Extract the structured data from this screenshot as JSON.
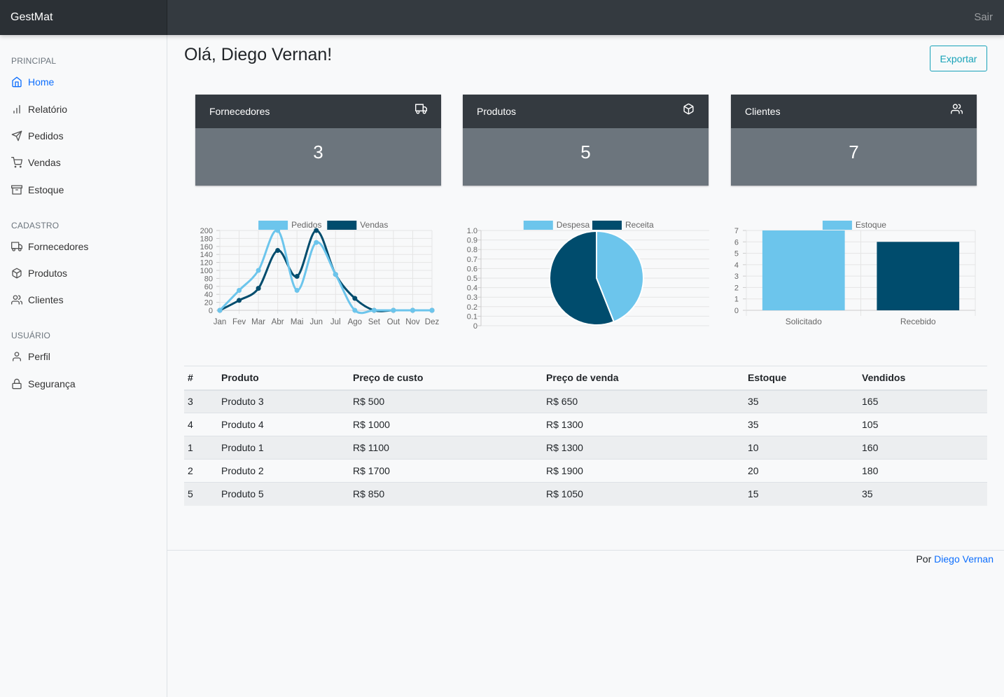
{
  "app": {
    "brand": "GestMat",
    "signout": "Sair"
  },
  "sidebar": {
    "sections": [
      {
        "heading": "PRINCIPAL",
        "items": [
          {
            "label": "Home",
            "icon": "home-icon",
            "active": true
          },
          {
            "label": "Relatório",
            "icon": "bar-chart-icon"
          },
          {
            "label": "Pedidos",
            "icon": "send-icon"
          },
          {
            "label": "Vendas",
            "icon": "shopping-cart-icon"
          },
          {
            "label": "Estoque",
            "icon": "archive-icon"
          }
        ]
      },
      {
        "heading": "CADASTRO",
        "items": [
          {
            "label": "Fornecedores",
            "icon": "truck-icon"
          },
          {
            "label": "Produtos",
            "icon": "package-icon"
          },
          {
            "label": "Clientes",
            "icon": "users-icon"
          }
        ]
      },
      {
        "heading": "USUÁRIO",
        "items": [
          {
            "label": "Perfil",
            "icon": "user-icon"
          },
          {
            "label": "Segurança",
            "icon": "lock-icon"
          }
        ]
      }
    ]
  },
  "main": {
    "greeting": "Olá, Diego Vernan!",
    "export_label": "Exportar",
    "cards": [
      {
        "title": "Fornecedores",
        "value": "3",
        "icon": "truck-icon"
      },
      {
        "title": "Produtos",
        "value": "5",
        "icon": "package-icon"
      },
      {
        "title": "Clientes",
        "value": "7",
        "icon": "users-icon"
      }
    ]
  },
  "colors": {
    "light": "#6cc5ec",
    "dark": "#004c6d",
    "accent": "#0d6efd",
    "outline": "#17a2b8"
  },
  "chart_data": [
    {
      "type": "line",
      "categories": [
        "Jan",
        "Fev",
        "Mar",
        "Abr",
        "Mai",
        "Jun",
        "Jul",
        "Ago",
        "Set",
        "Out",
        "Nov",
        "Dez"
      ],
      "series": [
        {
          "name": "Pedidos",
          "values": [
            0,
            50,
            100,
            200,
            50,
            170,
            90,
            0,
            0,
            0,
            0,
            0
          ]
        },
        {
          "name": "Vendas",
          "values": [
            0,
            25,
            55,
            150,
            85,
            200,
            90,
            30,
            0,
            0,
            0,
            0
          ]
        }
      ],
      "yticks": [
        "0",
        "20",
        "40",
        "60",
        "80",
        "100",
        "120",
        "140",
        "160",
        "180",
        "200"
      ],
      "ylim": [
        0,
        200
      ],
      "legend": "top",
      "grid": true
    },
    {
      "type": "pie",
      "series": [
        {
          "name": "Despesa",
          "value": 0.44
        },
        {
          "name": "Receita",
          "value": 0.56
        }
      ],
      "yticks": [
        "0",
        "0.1",
        "0.2",
        "0.3",
        "0.4",
        "0.5",
        "0.6",
        "0.7",
        "0.8",
        "0.9",
        "1.0"
      ],
      "legend": "top",
      "grid": true
    },
    {
      "type": "bar",
      "categories": [
        "Solicitado",
        "Recebido"
      ],
      "series": [
        {
          "name": "Estoque",
          "values": [
            7,
            6
          ]
        }
      ],
      "yticks": [
        "0",
        "1",
        "2",
        "3",
        "4",
        "5",
        "6",
        "7"
      ],
      "ylim": [
        0,
        7
      ],
      "legend": "top",
      "grid": true
    }
  ],
  "table": {
    "headers": [
      "#",
      "Produto",
      "Preço de custo",
      "Preço de venda",
      "Estoque",
      "Vendidos"
    ],
    "rows": [
      [
        "3",
        "Produto 3",
        "R$ 500",
        "R$ 650",
        "35",
        "165"
      ],
      [
        "4",
        "Produto 4",
        "R$ 1000",
        "R$ 1300",
        "35",
        "105"
      ],
      [
        "1",
        "Produto 1",
        "R$ 1100",
        "R$ 1300",
        "10",
        "160"
      ],
      [
        "2",
        "Produto 2",
        "R$ 1700",
        "R$ 1900",
        "20",
        "180"
      ],
      [
        "5",
        "Produto 5",
        "R$ 850",
        "R$ 1050",
        "15",
        "35"
      ]
    ]
  },
  "footer": {
    "prefix": "Por",
    "author": "Diego Vernan"
  }
}
